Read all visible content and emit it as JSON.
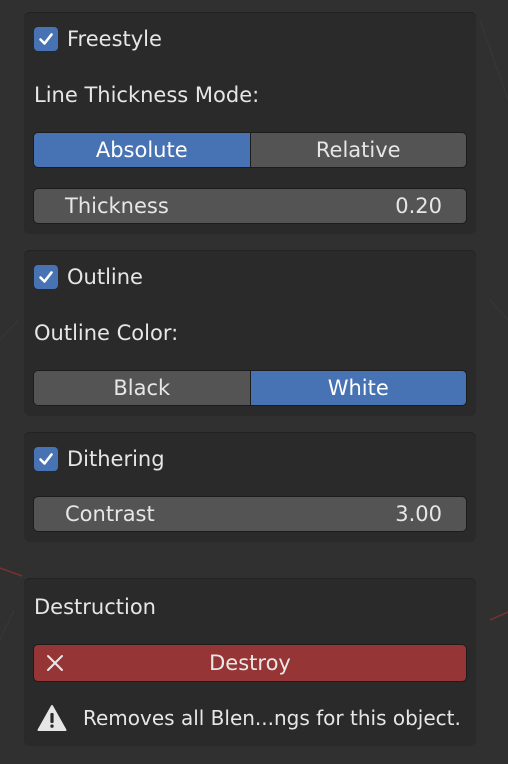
{
  "freestyle": {
    "label": "Freestyle",
    "checked": true,
    "mode_label": "Line Thickness Mode:",
    "mode_options": [
      "Absolute",
      "Relative"
    ],
    "mode_selected": "Absolute",
    "thickness_label": "Thickness",
    "thickness_value": "0.20"
  },
  "outline": {
    "label": "Outline",
    "checked": true,
    "color_label": "Outline Color:",
    "color_options": [
      "Black",
      "White"
    ],
    "color_selected": "White"
  },
  "dithering": {
    "label": "Dithering",
    "checked": true,
    "contrast_label": "Contrast",
    "contrast_value": "3.00"
  },
  "destruction": {
    "title": "Destruction",
    "button_label": "Destroy",
    "button_icon": "close-icon",
    "warning_icon": "warning-icon",
    "warning_text": "Removes all Blen...ngs for this object."
  },
  "colors": {
    "accent": "#4772b3",
    "danger": "#963535",
    "panel": "#2a2a2a",
    "widget": "#545454"
  }
}
